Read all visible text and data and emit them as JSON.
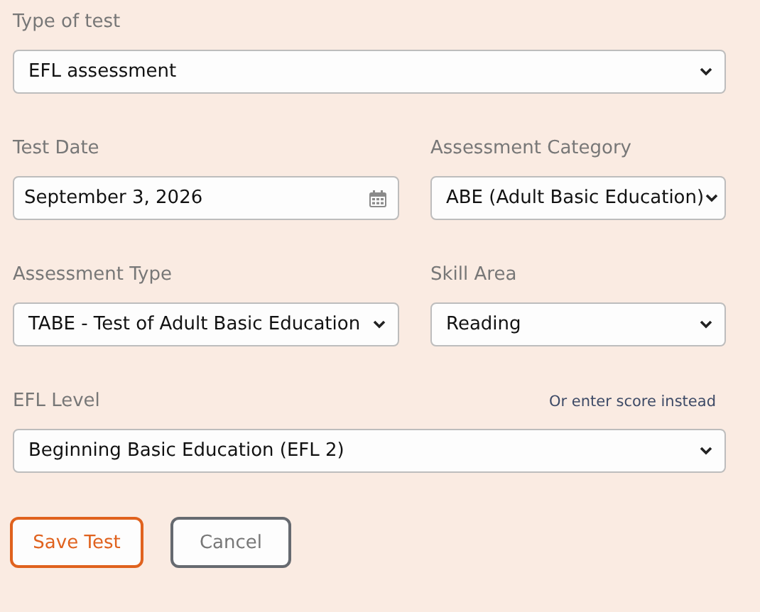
{
  "rows": [
    {
      "fields": [
        {
          "label": "Type of test",
          "kind": "select",
          "value": "EFL assessment"
        }
      ]
    },
    {
      "fields": [
        {
          "label": "Test Date",
          "kind": "date",
          "value": "September 3, 2026"
        },
        {
          "label": "Assessment Category",
          "kind": "select",
          "value": "ABE (Adult Basic Education)"
        }
      ]
    },
    {
      "fields": [
        {
          "label": "Assessment Type",
          "kind": "select",
          "value": "TABE - Test of Adult Basic Education"
        },
        {
          "label": "Skill Area",
          "kind": "select",
          "value": "Reading"
        }
      ]
    },
    {
      "fields": [
        {
          "label": "EFL Level",
          "kind": "select",
          "value": "Beginning Basic Education (EFL 2)",
          "link": "Or enter score instead"
        }
      ]
    }
  ],
  "buttons": [
    {
      "label": "Save Test",
      "kind": "primary"
    },
    {
      "label": "Cancel",
      "kind": "secondary"
    }
  ]
}
